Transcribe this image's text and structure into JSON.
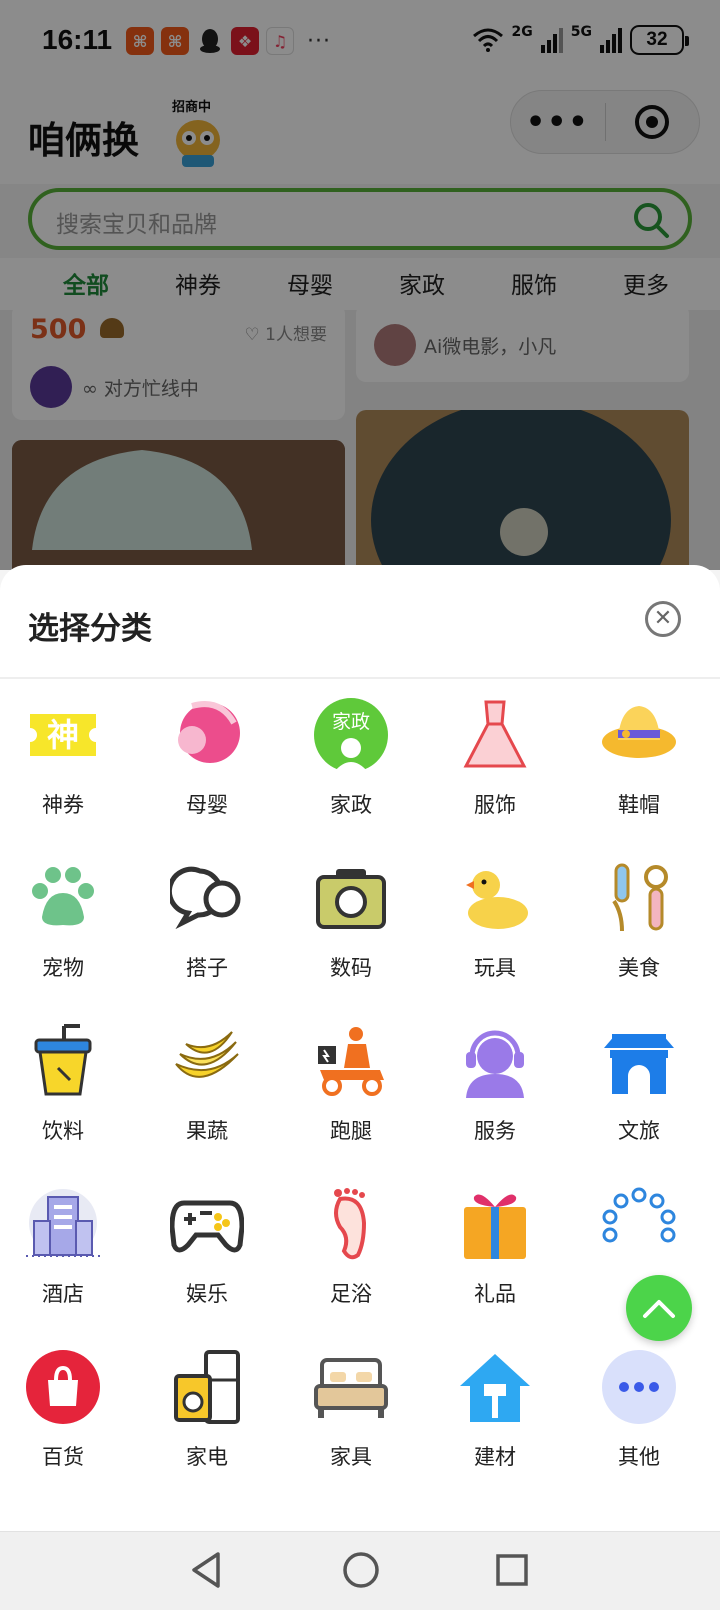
{
  "status_bar": {
    "time": "16:11",
    "more": "···",
    "network_1": "2G",
    "network_2": "5G",
    "battery": "32"
  },
  "header": {
    "app_title": "咱俩换",
    "mascot_tag": "招商中"
  },
  "search": {
    "placeholder": "搜索宝贝和品牌"
  },
  "tabs": [
    {
      "label": "全部",
      "active": true
    },
    {
      "label": "神券"
    },
    {
      "label": "母婴"
    },
    {
      "label": "家政"
    },
    {
      "label": "服饰"
    },
    {
      "label": "更多"
    }
  ],
  "feed": {
    "card1": {
      "price": "500",
      "want": "1人想要",
      "status": "对方忙线中"
    },
    "card2": {
      "author": "Ai微电影，小凡"
    }
  },
  "sheet": {
    "title": "选择分类",
    "categories": [
      {
        "label": "神券",
        "icon": "coupon-icon"
      },
      {
        "label": "母婴",
        "icon": "mother-baby-icon"
      },
      {
        "label": "家政",
        "icon": "housekeeping-icon",
        "icon_text": "家政"
      },
      {
        "label": "服饰",
        "icon": "dress-icon"
      },
      {
        "label": "鞋帽",
        "icon": "hat-icon"
      },
      {
        "label": "宠物",
        "icon": "paw-icon"
      },
      {
        "label": "搭子",
        "icon": "chat-bubbles-icon"
      },
      {
        "label": "数码",
        "icon": "camera-icon"
      },
      {
        "label": "玩具",
        "icon": "duck-icon"
      },
      {
        "label": "美食",
        "icon": "cutlery-icon"
      },
      {
        "label": "饮料",
        "icon": "drink-cup-icon"
      },
      {
        "label": "果蔬",
        "icon": "banana-icon"
      },
      {
        "label": "跑腿",
        "icon": "delivery-scooter-icon"
      },
      {
        "label": "服务",
        "icon": "customer-service-icon"
      },
      {
        "label": "文旅",
        "icon": "pavilion-icon"
      },
      {
        "label": "酒店",
        "icon": "hotel-building-icon"
      },
      {
        "label": "娱乐",
        "icon": "gamepad-icon"
      },
      {
        "label": "足浴",
        "icon": "foot-icon"
      },
      {
        "label": "礼品",
        "icon": "gift-box-icon"
      },
      {
        "label": "",
        "icon": "bead-bracelet-icon"
      },
      {
        "label": "百货",
        "icon": "shopping-bag-icon"
      },
      {
        "label": "家电",
        "icon": "appliance-icon"
      },
      {
        "label": "家具",
        "icon": "bed-icon"
      },
      {
        "label": "建材",
        "icon": "building-material-icon"
      },
      {
        "label": "其他",
        "icon": "more-dots-icon"
      }
    ]
  },
  "colors": {
    "accent_green": "#58b13a",
    "tab_active": "#1f8a3b",
    "price_orange": "#e05a2a",
    "fab_green": "#4cd44a"
  }
}
